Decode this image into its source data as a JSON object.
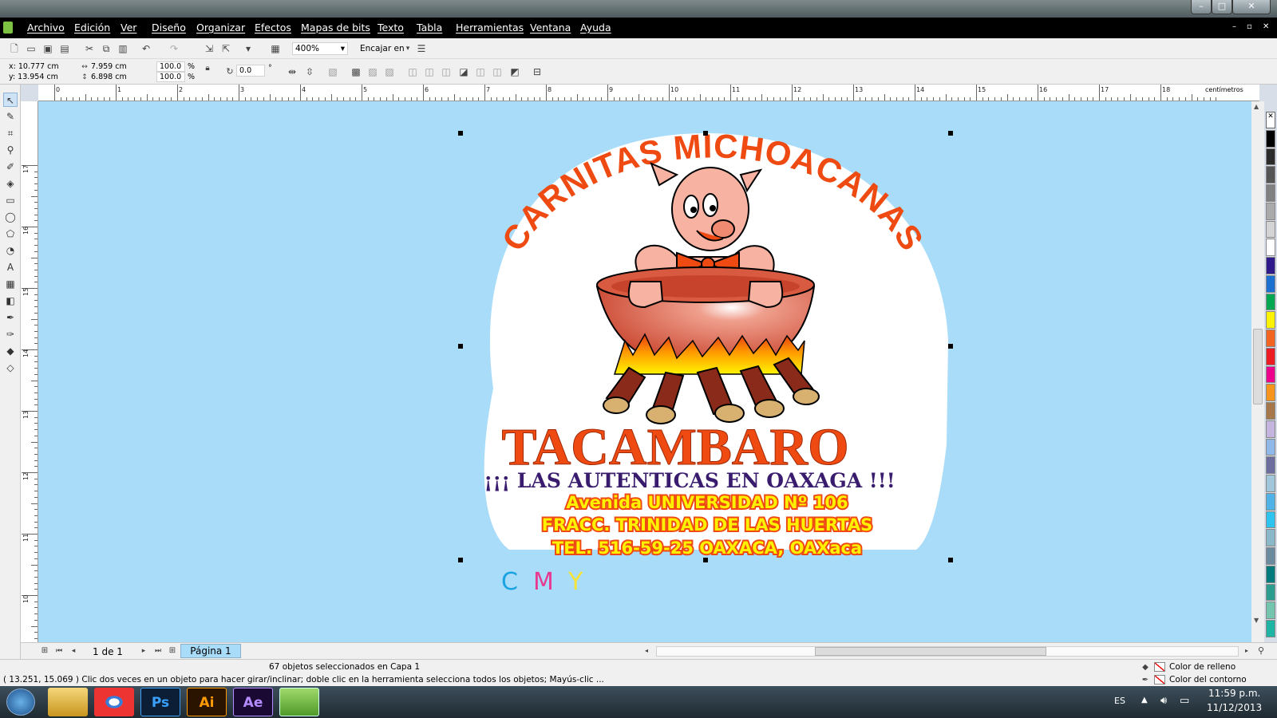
{
  "window": {
    "minimize_glyph": "–",
    "maximize_glyph": "□",
    "close_glyph": "✕"
  },
  "menu": {
    "items": [
      "Archivo",
      "Edición",
      "Ver",
      "Diseño",
      "Organizar",
      "Efectos",
      "Mapas de bits",
      "Texto",
      "Tabla",
      "Herramientas",
      "Ventana",
      "Ayuda"
    ]
  },
  "toolbar": {
    "zoom_value": "400%",
    "snap_label": "Encajar en"
  },
  "properties": {
    "x": "x: 10.777 cm",
    "y": "y: 13.954 cm",
    "width": "7.959 cm",
    "height": "6.898 cm",
    "scale_w": "100.0",
    "scale_h": "100.0",
    "percent": "%",
    "rotation": "0.0",
    "degree": "°"
  },
  "rulers": {
    "top_labels": [
      "0",
      "1",
      "2",
      "3",
      "4",
      "5",
      "6",
      "7",
      "8",
      "9",
      "10",
      "11",
      "12",
      "13",
      "14",
      "15",
      "16",
      "17",
      "18"
    ],
    "left_labels": [
      "17",
      "16",
      "15",
      "14",
      "13",
      "12",
      "11",
      "10"
    ],
    "unit": "centímetros"
  },
  "artwork": {
    "arc_title": "CARNITAS MICHOACANAS",
    "town": "TACAMBARO",
    "slogan": "¡¡¡ LAS  AUTENTICAS EN  OAXAGA !!!",
    "address1": "Avenida  UNIVERSIDAD Nº 106",
    "address2": "FRACC. TRINIDAD DE LAS HUERTAS",
    "address3": "TEL. 516-59-25   OAXACA, OAXaca",
    "cmy_c": "C",
    "cmy_m": "M",
    "cmy_y": "Y"
  },
  "pages": {
    "counter": "1 de 1",
    "tab": "Página 1"
  },
  "status": {
    "selection": "67 objetos seleccionados en Capa 1",
    "hint": "( 13.251, 15.069 )   Clic dos veces en un objeto para hacer girar/inclinar; doble clic en la herramienta selecciona todos los objetos; Mayús-clic ...",
    "fill_label": "Color de relleno",
    "outline_label": "Color del contorno"
  },
  "taskbar": {
    "lang": "ES",
    "time": "11:59 p.m.",
    "date": "11/12/2013",
    "apps": [
      "Ps",
      "Ai",
      "Ae"
    ]
  },
  "colors": {
    "canvas_bg": "#a8dcf8",
    "title_red": "#ee4a12",
    "slogan_purple": "#3a1c6e",
    "address_yellow": "#fff200",
    "cyan": "#1aa3e0",
    "magenta": "#e8388f",
    "yellow": "#f6e43a"
  },
  "palette": [
    "#000000",
    "#2b2b2b",
    "#555555",
    "#808080",
    "#aaaaaa",
    "#d4d4d4",
    "#ffffff",
    "#2e1a8a",
    "#1a6fd0",
    "#00a651",
    "#fff200",
    "#f26522",
    "#ed1c24",
    "#ec008c",
    "#f7941d",
    "#a5774a",
    "#c4b5e0",
    "#8fb7e8",
    "#6d6e9e",
    "#a1c6d9",
    "#4fb3e8",
    "#2ec4f0",
    "#8ab8c8",
    "#6a8a9e",
    "#007a7a",
    "#2a9d8f",
    "#73c5b0",
    "#1fb5a5"
  ]
}
